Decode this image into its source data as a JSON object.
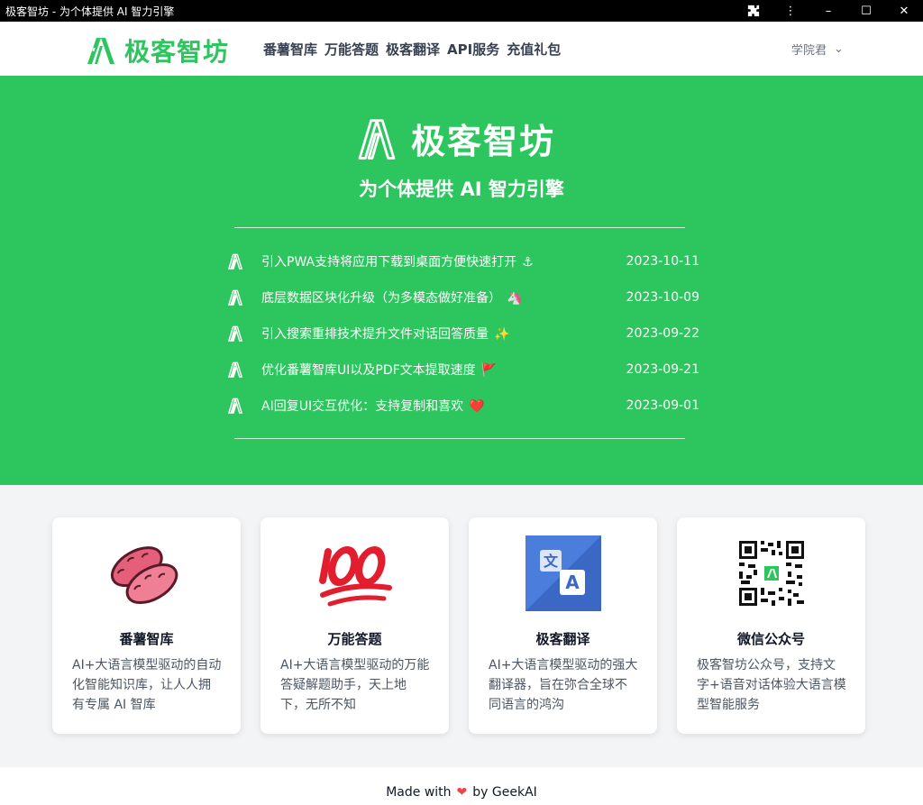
{
  "window": {
    "title": "极客智坊 - 为个体提供 AI 智力引擎",
    "extensions_icon": "puzzle-icon",
    "menu_icon": "⋮",
    "minimize": "–",
    "maximize": "☐",
    "close": "✕"
  },
  "nav": {
    "logo_text": "极客智坊",
    "menu": [
      "番薯智库",
      "万能答题",
      "极客翻译",
      "API服务",
      "充值礼包"
    ],
    "user_name": "学院君",
    "user_chevron": "⌄"
  },
  "hero": {
    "brand": "极客智坊",
    "tagline": "为个体提供 AI 智力引擎",
    "news": [
      {
        "text": "引入PWA支持将应用下载到桌面方便快速打开",
        "emoji": "⚓",
        "date": "2023-10-11"
      },
      {
        "text": "底层数据区块化升级（为多模态做好准备）",
        "emoji": "🦄",
        "date": "2023-10-09"
      },
      {
        "text": "引入搜索重排技术提升文件对话回答质量",
        "emoji": "✨",
        "date": "2023-09-22"
      },
      {
        "text": "优化番薯智库UI以及PDF文本提取速度",
        "emoji": "🚩",
        "date": "2023-09-21"
      },
      {
        "text": "AI回复UI交互优化：支持复制和喜欢",
        "emoji": "❤️",
        "date": "2023-09-01"
      }
    ]
  },
  "cards": [
    {
      "title": "番薯智库",
      "desc": "AI+大语言模型驱动的自动化智能知识库，让人人拥有专属 AI 智库",
      "icon": "sweet-potato-icon"
    },
    {
      "title": "万能答题",
      "desc": "AI+大语言模型驱动的万能答疑解题助手，天上地下，无所不知",
      "icon": "hundred-points-icon"
    },
    {
      "title": "极客翻译",
      "desc": "AI+大语言模型驱动的强大翻译器，旨在弥合全球不同语言的鸿沟",
      "icon": "translate-icon"
    },
    {
      "title": "微信公众号",
      "desc": "极客智坊公众号，支持文字+语音对话体验大语言模型智能服务",
      "icon": "qr-code-icon"
    }
  ],
  "footer": {
    "made_with": "Made with",
    "by": "by GeekAI",
    "heart": "❤"
  },
  "colors": {
    "brand_green": "#2dc55e",
    "heart_red": "#ef4444"
  }
}
